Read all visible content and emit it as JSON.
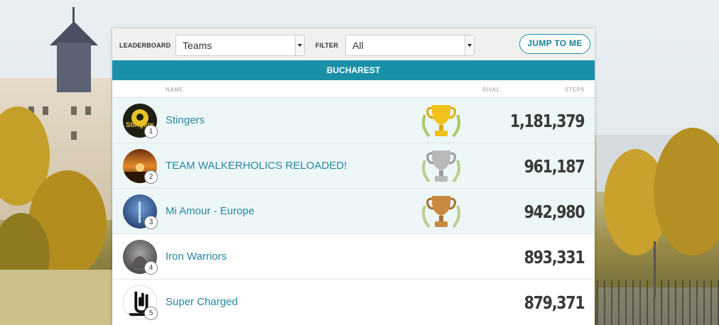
{
  "toolbar": {
    "leaderboard_label": "LEADERBOARD",
    "leaderboard_value": "Teams",
    "filter_label": "FILTER",
    "filter_value": "All",
    "jump_label": "JUMP TO ME"
  },
  "region": "BUCHAREST",
  "columns": {
    "name": "NAME",
    "rival": "RIVAL",
    "steps": "STEPS"
  },
  "colors": {
    "accent": "#1a8fa8",
    "gold": "#f2c21b",
    "silver": "#b9b9b9",
    "bronze": "#c98a3f",
    "highlight_row": "#eef7f7"
  },
  "rows": [
    {
      "rank": "1",
      "name": "Stingers",
      "steps": "1,181,379",
      "trophy": "gold-trophy-icon"
    },
    {
      "rank": "2",
      "name": "TEAM WALKERHOLICS RELOADED!",
      "steps": "961,187",
      "trophy": "silver-trophy-icon"
    },
    {
      "rank": "3",
      "name": "Mi Amour - Europe",
      "steps": "942,980",
      "trophy": "bronze-trophy-icon"
    },
    {
      "rank": "4",
      "name": "Iron Warriors",
      "steps": "893,331"
    },
    {
      "rank": "5",
      "name": "Super Charged",
      "steps": "879,371"
    }
  ]
}
